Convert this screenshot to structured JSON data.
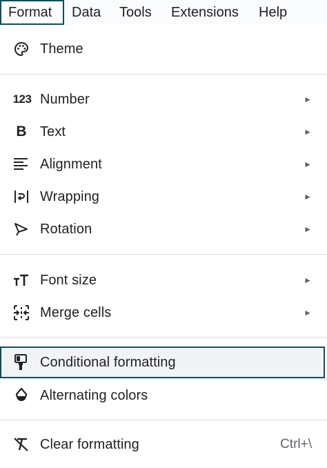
{
  "menubar": {
    "items": [
      "Format",
      "Data",
      "Tools",
      "Extensions",
      "Help"
    ]
  },
  "menu": {
    "theme": {
      "label": "Theme",
      "icon": "palette-icon"
    },
    "number": {
      "label": "Number",
      "icon": "number-123-icon",
      "icon_text": "123"
    },
    "text": {
      "label": "Text",
      "icon": "bold-icon",
      "icon_text": "B"
    },
    "alignment": {
      "label": "Alignment",
      "icon": "align-left-icon"
    },
    "wrapping": {
      "label": "Wrapping",
      "icon": "wrap-icon"
    },
    "rotation": {
      "label": "Rotation",
      "icon": "rotation-icon"
    },
    "font_size": {
      "label": "Font size",
      "icon": "font-size-icon"
    },
    "merge_cells": {
      "label": "Merge cells",
      "icon": "merge-cells-icon"
    },
    "conditional_formatting": {
      "label": "Conditional formatting",
      "icon": "paint-roller-icon",
      "highlighted": true
    },
    "alternating_colors": {
      "label": "Alternating colors",
      "icon": "fill-drop-icon"
    },
    "clear_formatting": {
      "label": "Clear formatting",
      "icon": "clear-format-icon",
      "shortcut": "Ctrl+\\"
    }
  },
  "submenu_arrow": "►",
  "colors": {
    "accent_border": "#0f4c5c",
    "highlight_bg": "#f1f3f4",
    "text": "#202124",
    "muted": "#5f6368"
  }
}
